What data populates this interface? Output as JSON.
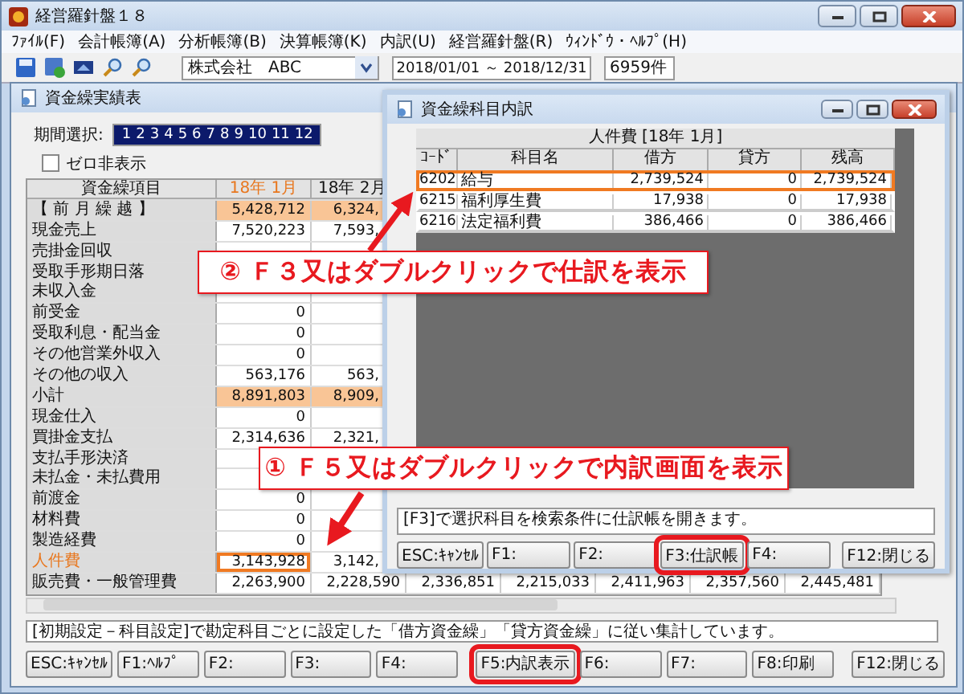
{
  "app": {
    "title": "経営羅針盤１８"
  },
  "menu": [
    "ﾌｧｲﾙ(F)",
    "会計帳簿(A)",
    "分析帳簿(B)",
    "決算帳簿(K)",
    "内訳(U)",
    "経営羅針盤(R)",
    "ｳｨﾝﾄﾞｳ・ﾍﾙﾌﾟ(H)"
  ],
  "toolbar": {
    "company": "株式会社　ABC",
    "period": "2018/01/01 ～ 2018/12/31",
    "count": "6959件"
  },
  "report_window": {
    "title": "資金繰実績表",
    "period_label": "期間選択:",
    "periods": [
      {
        "label": "1",
        "selected": true
      },
      {
        "label": "2",
        "selected": true
      },
      {
        "label": "3",
        "selected": true
      },
      {
        "label": "4",
        "selected": true
      },
      {
        "label": "5",
        "selected": true
      },
      {
        "label": "6",
        "selected": true
      },
      {
        "label": "7",
        "selected": true
      },
      {
        "label": "8",
        "selected": true
      },
      {
        "label": "9",
        "selected": true
      },
      {
        "label": "10",
        "selected": true
      },
      {
        "label": "11",
        "selected": true
      },
      {
        "label": "12",
        "selected": true
      }
    ],
    "zero_hide": {
      "label": "ゼロ非表示",
      "checked": false
    },
    "label_header": "資金繰項目",
    "columns": [
      {
        "label": "18年 1月",
        "selected": true
      },
      {
        "label": "18年 2月",
        "selected": false
      }
    ],
    "rows": [
      {
        "kind": "total",
        "label": "【 前 月 繰 越 】",
        "selected": false,
        "cells": [
          "5,428,712",
          "6,324,"
        ]
      },
      {
        "kind": "item",
        "label": "現金売上",
        "selected": false,
        "cells": [
          "7,520,223",
          "7,593,"
        ]
      },
      {
        "kind": "item",
        "label": "売掛金回収",
        "selected": false,
        "cells": []
      },
      {
        "kind": "item",
        "label": "受取手形期日落",
        "selected": false,
        "cells": []
      },
      {
        "kind": "item",
        "label": "未収入金",
        "selected": false,
        "cells": []
      },
      {
        "kind": "item",
        "label": "前受金",
        "selected": false,
        "cells": [
          "0"
        ]
      },
      {
        "kind": "item",
        "label": "受取利息・配当金",
        "selected": false,
        "cells": [
          "0"
        ]
      },
      {
        "kind": "item",
        "label": "その他営業外収入",
        "selected": false,
        "cells": [
          "0"
        ]
      },
      {
        "kind": "item",
        "label": "その他の収入",
        "selected": false,
        "cells": [
          "563,176",
          "563,"
        ]
      },
      {
        "kind": "total",
        "label": "小計",
        "selected": false,
        "cells": [
          "8,891,803",
          "8,909,"
        ]
      },
      {
        "kind": "item",
        "label": "現金仕入",
        "selected": false,
        "cells": [
          "0"
        ]
      },
      {
        "kind": "item",
        "label": "買掛金支払",
        "selected": false,
        "cells": [
          "2,314,636",
          "2,321,"
        ]
      },
      {
        "kind": "item",
        "label": "支払手形決済",
        "selected": false,
        "cells": []
      },
      {
        "kind": "item",
        "label": "未払金・未払費用",
        "selected": false,
        "cells": []
      },
      {
        "kind": "item",
        "label": "前渡金",
        "selected": false,
        "cells": [
          "0"
        ]
      },
      {
        "kind": "item",
        "label": "材料費",
        "selected": false,
        "cells": [
          "0"
        ]
      },
      {
        "kind": "item",
        "label": "製造経費",
        "selected": false,
        "cells": [
          "0"
        ]
      },
      {
        "kind": "item",
        "label": "人件費",
        "selected": true,
        "cells": [
          "3,143,928",
          "3,142,"
        ]
      },
      {
        "kind": "item",
        "label": "販売費・一般管理費",
        "selected": false,
        "cells": [
          "2,263,900",
          "2,228,590",
          "2,336,851",
          "2,215,033",
          "2,411,963",
          "2,357,560",
          "2,445,481"
        ]
      }
    ],
    "message": "[初期設定－科目設定]で勘定科目ごとに設定した「借方資金繰」「貸方資金繰」に従い集計しています。",
    "buttons": [
      {
        "label": "ESC:ｷｬﾝｾﾙ",
        "emphasized": false
      },
      {
        "label": "F1:ﾍﾙﾌﾟ",
        "emphasized": false
      },
      {
        "label": "F2:",
        "emphasized": false
      },
      {
        "label": "F3:",
        "emphasized": false
      },
      {
        "label": "F4:",
        "emphasized": false
      },
      {
        "label": "F5:内訳表示",
        "emphasized": true
      },
      {
        "label": "F6:",
        "emphasized": false
      },
      {
        "label": "F7:",
        "emphasized": false
      },
      {
        "label": "F8:印刷",
        "emphasized": false
      },
      {
        "label": "F12:閉じる",
        "emphasized": false
      }
    ]
  },
  "detail_window": {
    "title": "資金繰科目内訳",
    "table_title": "人件費 [18年 1月]",
    "columns": [
      "ｺｰﾄﾞ",
      "科目名",
      "借方",
      "貸方",
      "残高"
    ],
    "rows": [
      {
        "code": "6202",
        "name": "給与",
        "debit": "2,739,524",
        "credit": "0",
        "balance": "2,739,524",
        "selected": true
      },
      {
        "code": "6215",
        "name": "福利厚生費",
        "debit": "17,938",
        "credit": "0",
        "balance": "17,938",
        "selected": false
      },
      {
        "code": "6216",
        "name": "法定福利費",
        "debit": "386,466",
        "credit": "0",
        "balance": "386,466",
        "selected": false
      }
    ],
    "message": "[F3]で選択科目を検索条件に仕訳帳を開きます。",
    "buttons": [
      {
        "label": "ESC:ｷｬﾝｾﾙ",
        "emphasized": false
      },
      {
        "label": "F1:",
        "emphasized": false
      },
      {
        "label": "F2:",
        "emphasized": false
      },
      {
        "label": "F3:仕訳帳",
        "emphasized": true
      },
      {
        "label": "F4:",
        "emphasized": false
      },
      {
        "label": "F12:閉じる",
        "emphasized": false
      }
    ]
  },
  "callouts": [
    {
      "text": "② Ｆ３又はダブルクリックで仕訳を表示"
    },
    {
      "text": "① Ｆ５又はダブルクリックで内訳画面を表示"
    }
  ]
}
